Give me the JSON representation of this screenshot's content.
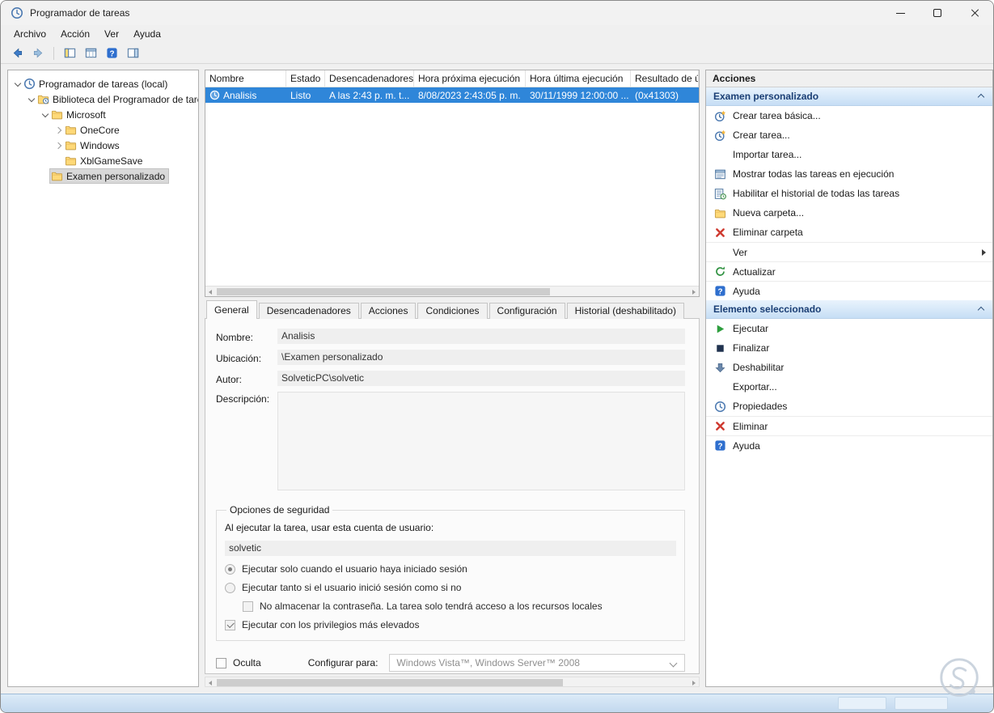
{
  "titlebar": {
    "title": "Programador de tareas"
  },
  "window_controls": [
    "minimize",
    "maximize",
    "close"
  ],
  "menubar": {
    "items": [
      "Archivo",
      "Acción",
      "Ver",
      "Ayuda"
    ]
  },
  "toolbar": {
    "buttons": [
      "back",
      "forward",
      "show-hide-console-tree",
      "export-list",
      "help",
      "show-hide-action-pane"
    ]
  },
  "tree": {
    "items": [
      {
        "label": "Programador de tareas (local)",
        "level": 0,
        "state": "expanded",
        "icon": "scheduler-clock"
      },
      {
        "label": "Biblioteca del Programador de tareas",
        "level": 1,
        "state": "expanded",
        "icon": "folder-clock"
      },
      {
        "label": "Microsoft",
        "level": 2,
        "state": "expanded",
        "icon": "folder"
      },
      {
        "label": "OneCore",
        "level": 3,
        "state": "collapsed",
        "icon": "folder"
      },
      {
        "label": "Windows",
        "level": 3,
        "state": "collapsed",
        "icon": "folder"
      },
      {
        "label": "XblGameSave",
        "level": 3,
        "state": "leaf",
        "icon": "folder"
      },
      {
        "label": "Examen personalizado",
        "level": 2,
        "state": "leaf",
        "icon": "folder",
        "selected": true
      }
    ]
  },
  "tasklist": {
    "columns": [
      "Nombre",
      "Estado",
      "Desencadenadores",
      "Hora próxima ejecución",
      "Hora última ejecución",
      "Resultado de ú"
    ],
    "rows": [
      {
        "selected": true,
        "icon": "task-clock",
        "nombre": "Analisis",
        "estado": "Listo",
        "desencadenadores": "A las 2:43 p. m. t...",
        "hora_proxima": "8/08/2023 2:43:05 p. m.",
        "hora_ultima": "30/11/1999 12:00:00 ...",
        "resultado": "(0x41303)"
      }
    ]
  },
  "tabs": {
    "items": [
      "General",
      "Desencadenadores",
      "Acciones",
      "Condiciones",
      "Configuración",
      "Historial (deshabilitado)"
    ],
    "active": "General"
  },
  "general_tab": {
    "nombre_label": "Nombre:",
    "nombre_value": "Analisis",
    "ubicacion_label": "Ubicación:",
    "ubicacion_value": "\\Examen personalizado",
    "autor_label": "Autor:",
    "autor_value": "SolveticPC\\solvetic",
    "descripcion_label": "Descripción:",
    "descripcion_value": "",
    "security": {
      "legend": "Opciones de seguridad",
      "account_caption": "Al ejecutar la tarea, usar esta cuenta de usuario:",
      "account_value": "solvetic",
      "radio_logged_in": {
        "label": "Ejecutar solo cuando el usuario haya iniciado sesión",
        "selected": true
      },
      "radio_any": {
        "label": "Ejecutar tanto si el usuario inició sesión como si no",
        "selected": false
      },
      "check_no_password": {
        "label": "No almacenar la contraseña. La tarea solo tendrá acceso a los recursos locales",
        "checked": false
      },
      "check_privileges": {
        "label": "Ejecutar con los privilegios más elevados",
        "checked": true
      }
    },
    "oculta": {
      "label": "Oculta",
      "checked": false
    },
    "configurar_label": "Configurar para:",
    "configurar_value": "Windows Vista™, Windows Server™ 2008"
  },
  "actions_pane": {
    "title": "Acciones",
    "sections": [
      {
        "header": "Examen personalizado",
        "collapsed": false,
        "items": [
          {
            "label": "Crear tarea básica...",
            "icon": "new-task-clock"
          },
          {
            "label": "Crear tarea...",
            "icon": "new-task-clock"
          },
          {
            "label": "Importar tarea...",
            "icon": "none"
          },
          {
            "label": "Mostrar todas las tareas en ejecución",
            "icon": "running-tasks-list"
          },
          {
            "label": "Habilitar el historial de todas las tareas",
            "icon": "history-list"
          },
          {
            "label": "Nueva carpeta...",
            "icon": "folder"
          },
          {
            "label": "Eliminar carpeta",
            "icon": "delete-x"
          },
          {
            "label": "Ver",
            "icon": "none",
            "submenu": true
          },
          {
            "label": "Actualizar",
            "icon": "refresh"
          },
          {
            "label": "Ayuda",
            "icon": "help"
          }
        ]
      },
      {
        "header": "Elemento seleccionado",
        "collapsed": false,
        "items": [
          {
            "label": "Ejecutar",
            "icon": "play"
          },
          {
            "label": "Finalizar",
            "icon": "stop"
          },
          {
            "label": "Deshabilitar",
            "icon": "disable-arrow"
          },
          {
            "label": "Exportar...",
            "icon": "none"
          },
          {
            "label": "Propiedades",
            "icon": "properties-clock"
          },
          {
            "label": "Eliminar",
            "icon": "delete-x"
          },
          {
            "label": "Ayuda",
            "icon": "help"
          }
        ]
      }
    ]
  },
  "colors": {
    "selection_blue": "#2f86d9",
    "section_header_blue": "#cde3f7",
    "section_header_text": "#1a3e74",
    "statusbar_blue": "#cfe3f6",
    "folder_yellow": "#ffd978",
    "delete_red": "#cf3a30",
    "run_green": "#2e9e3e"
  }
}
